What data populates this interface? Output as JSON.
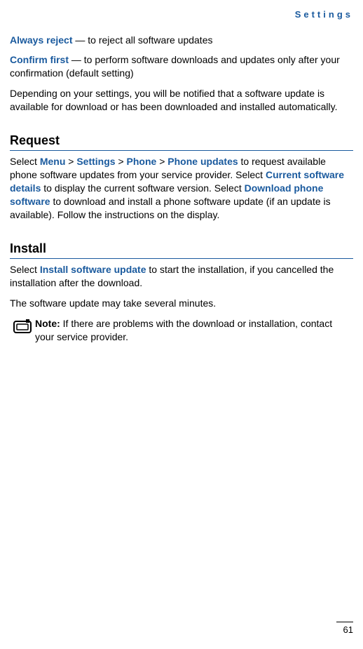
{
  "header": {
    "title": "Settings"
  },
  "intro": {
    "always_reject_label": "Always reject",
    "always_reject_rest": " — to reject all software updates",
    "confirm_first_label": "Confirm first",
    "confirm_first_rest": " — to perform software downloads and updates only after your confirmation (default setting)",
    "depending_text": "Depending on your settings, you will be notified that a software update is available for download or has been downloaded and installed automatically."
  },
  "request": {
    "heading": "Request",
    "p1_a": "Select ",
    "menu": "Menu",
    "gt1": " > ",
    "settings": "Settings",
    "gt2": " > ",
    "phone": "Phone",
    "gt3": " > ",
    "phone_updates": "Phone updates",
    "p1_b": " to request available phone software updates from your service provider. Select ",
    "current_sw": "Current software details",
    "p1_c": " to display the current software version. Select ",
    "download_sw": "Download phone software",
    "p1_d": " to download and install a phone software update (if an update is available). Follow the instructions on the display."
  },
  "install": {
    "heading": "Install",
    "p1_a": "Select ",
    "install_sw": "Install software update",
    "p1_b": " to start the installation, if you cancelled the installation after the download.",
    "p2": "The software update may take several minutes.",
    "note_label": "Note:",
    "note_text": " If there are problems with the download or installation, contact your service provider."
  },
  "page_number": "61"
}
